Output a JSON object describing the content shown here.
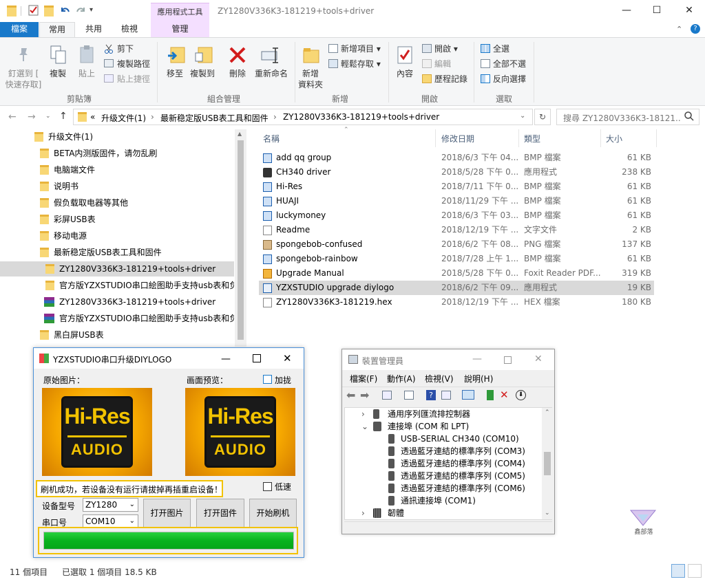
{
  "window": {
    "title": "ZY1280V336K3-181219+tools+driver",
    "contextual_tab_group": "應用程式工具",
    "controls": {
      "minimize": "—",
      "maximize": "☐",
      "close": "✕"
    }
  },
  "tabs": {
    "file": "檔案",
    "home": "常用",
    "share": "共用",
    "view": "檢視",
    "manage": "管理"
  },
  "ribbon": {
    "clipboard": {
      "pin": "釘選到 [\n快速存取]",
      "copy": "複製",
      "paste": "貼上",
      "cut": "剪下",
      "copy_path": "複製路徑",
      "paste_shortcut": "貼上捷徑",
      "group": "剪貼簿"
    },
    "organize": {
      "move_to": "移至",
      "copy_to": "複製到",
      "delete": "刪除",
      "rename": "重新命名",
      "group": "組合管理"
    },
    "new": {
      "new_folder": "新增\n資料夾",
      "new_item": "新增項目 ▾",
      "easy_access": "輕鬆存取 ▾",
      "group": "新增"
    },
    "open": {
      "properties": "內容",
      "open": "開啟 ▾",
      "edit": "編輯",
      "history": "歷程記錄",
      "group": "開啟"
    },
    "select": {
      "select_all": "全選",
      "select_none": "全部不選",
      "invert": "反向選擇",
      "group": "選取"
    }
  },
  "address": {
    "prefix": "«",
    "crumbs": [
      "升级文件(1)",
      "最新稳定版USB表工具和固件",
      "ZY1280V336K3-181219+tools+driver"
    ],
    "search_placeholder": "搜尋 ZY1280V336K3-18121..."
  },
  "tree": {
    "items": [
      {
        "label": "升级文件(1)"
      },
      {
        "label": "BETA内测版固件，请勿乱刷"
      },
      {
        "label": "电脑端文件"
      },
      {
        "label": "说明书"
      },
      {
        "label": "假负载取电器等其他"
      },
      {
        "label": "彩屏USB表"
      },
      {
        "label": "移动电源"
      },
      {
        "label": "最新稳定版USB表工具和固件"
      },
      {
        "label": "ZY1280V336K3-181219+tools+driver"
      },
      {
        "label": "官方版YZXSTUDIO串口絵图助手支持usb表和负"
      },
      {
        "label": "ZY1280V336K3-181219+tools+driver"
      },
      {
        "label": "官方版YZXSTUDIO串口絵图助手支持usb表和负"
      },
      {
        "label": "黑白屏USB表"
      }
    ]
  },
  "list": {
    "headers": {
      "name": "名稱",
      "date": "修改日期",
      "type": "類型",
      "size": "大小"
    },
    "rows": [
      {
        "name": "add qq group",
        "date": "2018/6/3 下午 04...",
        "type": "BMP 檔案",
        "size": "61 KB"
      },
      {
        "name": "CH340 driver",
        "date": "2018/5/28 下午 0...",
        "type": "應用程式",
        "size": "238 KB"
      },
      {
        "name": "Hi-Res",
        "date": "2018/7/11 下午 0...",
        "type": "BMP 檔案",
        "size": "61 KB"
      },
      {
        "name": "HUAJI",
        "date": "2018/11/29 下午 ...",
        "type": "BMP 檔案",
        "size": "61 KB"
      },
      {
        "name": "luckymoney",
        "date": "2018/6/3 下午 03...",
        "type": "BMP 檔案",
        "size": "61 KB"
      },
      {
        "name": "Readme",
        "date": "2018/12/19 下午 ...",
        "type": "文字文件",
        "size": "2 KB"
      },
      {
        "name": "spongebob-confused",
        "date": "2018/6/2 下午 08...",
        "type": "PNG 檔案",
        "size": "137 KB"
      },
      {
        "name": "spongebob-rainbow",
        "date": "2018/7/28 上午 1...",
        "type": "BMP 檔案",
        "size": "61 KB"
      },
      {
        "name": "Upgrade Manual",
        "date": "2018/5/28 下午 0...",
        "type": "Foxit Reader PDF...",
        "size": "319 KB"
      },
      {
        "name": "YZXSTUDIO upgrade diylogo",
        "date": "2018/6/2 下午 09...",
        "type": "應用程式",
        "size": "19 KB"
      },
      {
        "name": "ZY1280V336K3-181219.hex",
        "date": "2018/12/19 下午 ...",
        "type": "HEX 檔案",
        "size": "180 KB"
      }
    ]
  },
  "status": {
    "count": "11 個項目",
    "selected": "已選取 1 個項目  18.5 KB"
  },
  "upgrader": {
    "title": "YZXSTUDIO串口升级DIYLOGO",
    "original_label": "原始图片：",
    "preview_label": "画面预览：",
    "bold_label": "加拢",
    "low_speed_label": "低速",
    "logo_line1": "Hi-Res",
    "logo_line2": "AUDIO",
    "message": "刷机成功，若设备没有运行请拔掉再插重启设备！",
    "model_label": "设备型号",
    "model_value": "ZY1280",
    "port_label": "串口号",
    "port_value": "COM10",
    "open_image": "打开图片",
    "open_firmware": "打开固件",
    "start_flash": "开始刷机",
    "progress": 1.0
  },
  "device_manager": {
    "title": "裝置管理員",
    "menu": [
      "檔案(F)",
      "動作(A)",
      "檢視(V)",
      "說明(H)"
    ],
    "items": [
      {
        "label": "通用序列匯流排控制器",
        "level": 0,
        "expander": "›"
      },
      {
        "label": "連接埠 (COM 和 LPT)",
        "level": 0,
        "expander": "⌄"
      },
      {
        "label": "USB-SERIAL CH340 (COM10)",
        "level": 1,
        "expander": ""
      },
      {
        "label": "透過藍牙連結的標準序列 (COM3)",
        "level": 1,
        "expander": ""
      },
      {
        "label": "透過藍牙連結的標準序列 (COM4)",
        "level": 1,
        "expander": ""
      },
      {
        "label": "透過藍牙連結的標準序列 (COM5)",
        "level": 1,
        "expander": ""
      },
      {
        "label": "透過藍牙連結的標準序列 (COM6)",
        "level": 1,
        "expander": ""
      },
      {
        "label": "通訊連接埠 (COM1)",
        "level": 1,
        "expander": ""
      },
      {
        "label": "韌體",
        "level": 0,
        "expander": "›"
      }
    ]
  },
  "watermark": {
    "text": "鑫部落"
  },
  "colors": {
    "accent": "#1979ca",
    "selection": "#d9d9d9",
    "progress": "#06b01d",
    "highlight_border": "#f2c200",
    "context_tab": "#f4dfff"
  }
}
